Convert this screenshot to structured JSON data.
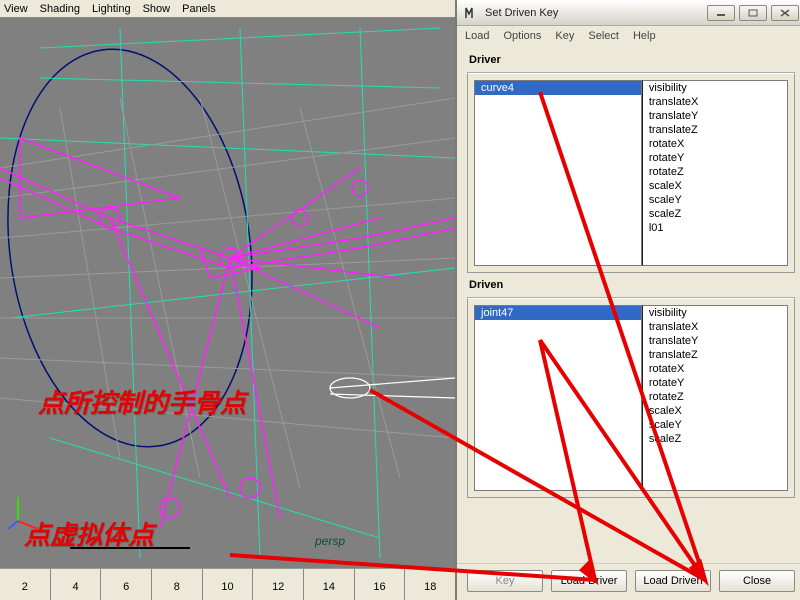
{
  "viewport": {
    "menu": {
      "view": "View",
      "shading": "Shading",
      "lighting": "Lighting",
      "show": "Show",
      "panels": "Panels"
    },
    "camera": "persp",
    "axis": {
      "y": "y",
      "z": "z"
    },
    "annotation1": "点所控制的手骨点",
    "annotation2": "点虚拟体点",
    "timeline": [
      "2",
      "4",
      "6",
      "8",
      "10",
      "12",
      "14",
      "16",
      "18"
    ]
  },
  "dialog": {
    "title": "Set Driven Key",
    "menu": {
      "load": "Load",
      "options": "Options",
      "key": "Key",
      "select": "Select",
      "help": "Help"
    },
    "driver": {
      "label": "Driver",
      "selected": "curve4",
      "attrs": [
        "visibility",
        "translateX",
        "translateY",
        "translateZ",
        "rotateX",
        "rotateY",
        "rotateZ",
        "scaleX",
        "scaleY",
        "scaleZ",
        "l01"
      ]
    },
    "driven": {
      "label": "Driven",
      "selected": "joint47",
      "attrs": [
        "visibility",
        "translateX",
        "translateY",
        "translateZ",
        "rotateX",
        "rotateY",
        "rotateZ",
        "scaleX",
        "scaleY",
        "scaleZ"
      ]
    },
    "buttons": {
      "key": "Key",
      "load_driver": "Load Driver",
      "load_driven": "Load Driven",
      "close": "Close"
    }
  }
}
